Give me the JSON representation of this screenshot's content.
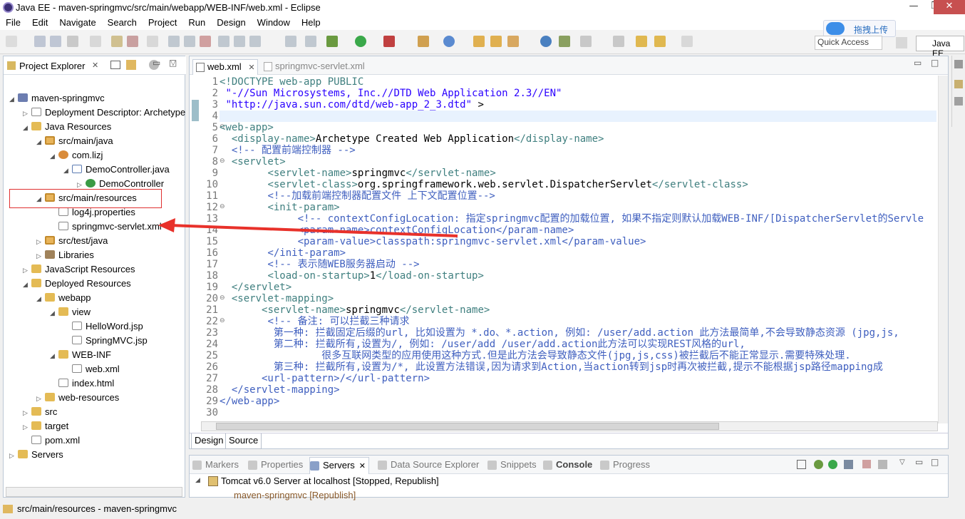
{
  "window": {
    "title": "Java EE - maven-springmvc/src/main/webapp/WEB-INF/web.xml - Eclipse"
  },
  "menu": [
    "File",
    "Edit",
    "Navigate",
    "Search",
    "Project",
    "Run",
    "Design",
    "Window",
    "Help"
  ],
  "toolbar": {
    "upload_label": "拖拽上传",
    "quick_access_placeholder": "Quick Access",
    "perspective": "Java EE"
  },
  "project_explorer": {
    "title": "Project Explorer",
    "tree": [
      {
        "label": "maven-springmvc",
        "indent": 0,
        "arrow": "open",
        "icon": "proj"
      },
      {
        "label": "Deployment Descriptor: Archetype",
        "indent": 1,
        "arrow": "closed",
        "icon": "file"
      },
      {
        "label": "Java Resources",
        "indent": 1,
        "arrow": "open",
        "icon": "folder"
      },
      {
        "label": "src/main/java",
        "indent": 2,
        "arrow": "open",
        "icon": "src"
      },
      {
        "label": "com.lizj",
        "indent": 3,
        "arrow": "open",
        "icon": "pkg"
      },
      {
        "label": "DemoController.java",
        "indent": 4,
        "arrow": "open",
        "icon": "java"
      },
      {
        "label": "DemoController",
        "indent": 5,
        "arrow": "closed",
        "icon": "cls"
      },
      {
        "label": "src/main/resources",
        "indent": 2,
        "arrow": "open",
        "icon": "src"
      },
      {
        "label": "log4j.properties",
        "indent": 3,
        "arrow": "",
        "icon": "file"
      },
      {
        "label": "springmvc-servlet.xml",
        "indent": 3,
        "arrow": "",
        "icon": "file"
      },
      {
        "label": "src/test/java",
        "indent": 2,
        "arrow": "closed",
        "icon": "src"
      },
      {
        "label": "Libraries",
        "indent": 2,
        "arrow": "closed",
        "icon": "lib"
      },
      {
        "label": "JavaScript Resources",
        "indent": 1,
        "arrow": "closed",
        "icon": "folder"
      },
      {
        "label": "Deployed Resources",
        "indent": 1,
        "arrow": "open",
        "icon": "folder"
      },
      {
        "label": "webapp",
        "indent": 2,
        "arrow": "open",
        "icon": "folder"
      },
      {
        "label": "view",
        "indent": 3,
        "arrow": "open",
        "icon": "folder"
      },
      {
        "label": "HelloWord.jsp",
        "indent": 4,
        "arrow": "",
        "icon": "jsp"
      },
      {
        "label": "SpringMVC.jsp",
        "indent": 4,
        "arrow": "",
        "icon": "jsp"
      },
      {
        "label": "WEB-INF",
        "indent": 3,
        "arrow": "open",
        "icon": "folder"
      },
      {
        "label": "web.xml",
        "indent": 4,
        "arrow": "",
        "icon": "file"
      },
      {
        "label": "index.html",
        "indent": 3,
        "arrow": "",
        "icon": "file"
      },
      {
        "label": "web-resources",
        "indent": 2,
        "arrow": "closed",
        "icon": "folder"
      },
      {
        "label": "src",
        "indent": 1,
        "arrow": "closed",
        "icon": "folder"
      },
      {
        "label": "target",
        "indent": 1,
        "arrow": "closed",
        "icon": "folder"
      },
      {
        "label": "pom.xml",
        "indent": 1,
        "arrow": "",
        "icon": "file"
      },
      {
        "label": "Servers",
        "indent": 0,
        "arrow": "closed",
        "icon": "folder"
      }
    ]
  },
  "editor": {
    "tabs": [
      "web.xml",
      "springmvc-servlet.xml"
    ],
    "lines": [
      "<!DOCTYPE web-app PUBLIC",
      " \"-//Sun Microsystems, Inc.//DTD Web Application 2.3//EN\"",
      " \"http://java.sun.com/dtd/web-app_2_3.dtd\" >",
      "",
      "<web-app>",
      "  <display-name>Archetype Created Web Application</display-name>",
      "  <!-- 配置前端控制器 -->",
      "  <servlet>",
      "        <servlet-name>springmvc</servlet-name>",
      "        <servlet-class>org.springframework.web.servlet.DispatcherServlet</servlet-class>",
      "        <!--加载前端控制器配置文件 上下文配置位置-->",
      "        <init-param>",
      "             <!-- contextConfigLocation: 指定springmvc配置的加载位置, 如果不指定则默认加载WEB-INF/[DispatcherServlet的Servle",
      "             <param-name>contextConfigLocation</param-name>",
      "             <param-value>classpath:springmvc-servlet.xml</param-value>",
      "        </init-param>",
      "        <!-- 表示随WEB服务器启动 -->",
      "        <load-on-startup>1</load-on-startup>",
      "  </servlet>",
      "  <servlet-mapping>",
      "       <servlet-name>springmvc</servlet-name>",
      "        <!-- 备注: 可以拦截三种请求",
      "         第一种: 拦截固定后缀的url, 比如设置为 *.do、*.action, 例如: /user/add.action 此方法最简单,不会导致静态资源 (jpg,js,",
      "         第二种: 拦截所有,设置为/, 例如: /user/add /user/add.action此方法可以实现REST风格的url,",
      "                 很多互联网类型的应用使用这种方式.但是此方法会导致静态文件(jpg,js,css)被拦截后不能正常显示.需要特殊处理.",
      "         第三种: 拦截所有,设置为/*, 此设置方法错误,因为请求到Action,当action转到jsp时再次被拦截,提示不能根据jsp路径mapping成",
      "       <url-pattern>/</url-pattern>",
      "  </servlet-mapping>",
      "</web-app>",
      ""
    ],
    "bottom_tabs": [
      "Design",
      "Source"
    ]
  },
  "servers_view": {
    "tabs": [
      "Markers",
      "Properties",
      "Servers",
      "Data Source Explorer",
      "Snippets",
      "Console",
      "Progress"
    ],
    "server": "Tomcat v6.0 Server at localhost  [Stopped, Republish]",
    "child": "maven-springmvc  [Republish]"
  },
  "status": "src/main/resources - maven-springmvc"
}
